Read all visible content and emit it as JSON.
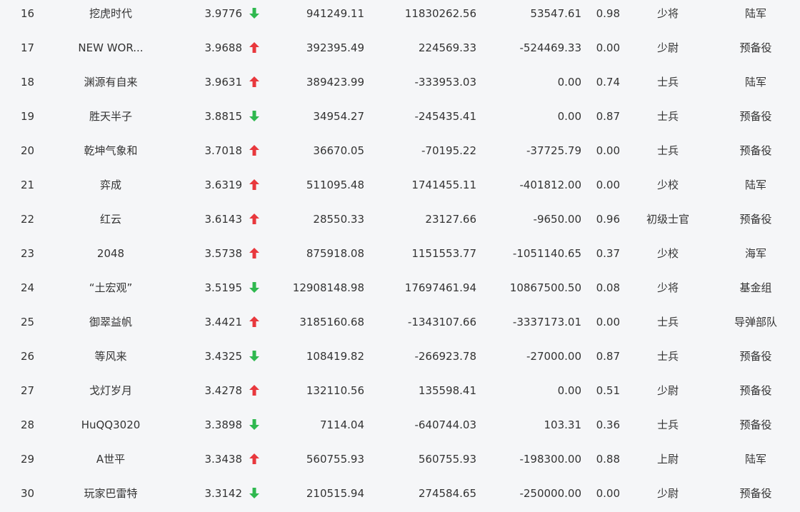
{
  "colors": {
    "up": "#e8383d",
    "down": "#2fb84f",
    "text": "#333333",
    "background": "#f5f6f8"
  },
  "rows": [
    {
      "rank": "16",
      "name": "挖虎时代",
      "score": "3.9776",
      "trend": "down",
      "v1": "941249.11",
      "v2": "11830262.56",
      "v3": "53547.61",
      "ratio": "0.98",
      "level": "少将",
      "unit": "陆军"
    },
    {
      "rank": "17",
      "name": "NEW WOR...",
      "score": "3.9688",
      "trend": "up",
      "v1": "392395.49",
      "v2": "224569.33",
      "v3": "-524469.33",
      "ratio": "0.00",
      "level": "少尉",
      "unit": "预备役"
    },
    {
      "rank": "18",
      "name": "渊源有自来",
      "score": "3.9631",
      "trend": "up",
      "v1": "389423.99",
      "v2": "-333953.03",
      "v3": "0.00",
      "ratio": "0.74",
      "level": "士兵",
      "unit": "陆军"
    },
    {
      "rank": "19",
      "name": "胜天半子",
      "score": "3.8815",
      "trend": "down",
      "v1": "34954.27",
      "v2": "-245435.41",
      "v3": "0.00",
      "ratio": "0.87",
      "level": "士兵",
      "unit": "预备役"
    },
    {
      "rank": "20",
      "name": "乾坤气象和",
      "score": "3.7018",
      "trend": "up",
      "v1": "36670.05",
      "v2": "-70195.22",
      "v3": "-37725.79",
      "ratio": "0.00",
      "level": "士兵",
      "unit": "预备役"
    },
    {
      "rank": "21",
      "name": "弈成",
      "score": "3.6319",
      "trend": "up",
      "v1": "511095.48",
      "v2": "1741455.11",
      "v3": "-401812.00",
      "ratio": "0.00",
      "level": "少校",
      "unit": "陆军"
    },
    {
      "rank": "22",
      "name": "红云",
      "score": "3.6143",
      "trend": "up",
      "v1": "28550.33",
      "v2": "23127.66",
      "v3": "-9650.00",
      "ratio": "0.96",
      "level": "初级士官",
      "unit": "预备役"
    },
    {
      "rank": "23",
      "name": "2048",
      "score": "3.5738",
      "trend": "up",
      "v1": "875918.08",
      "v2": "1151553.77",
      "v3": "-1051140.65",
      "ratio": "0.37",
      "level": "少校",
      "unit": "海军"
    },
    {
      "rank": "24",
      "name": "“土宏观”",
      "score": "3.5195",
      "trend": "down",
      "v1": "12908148.98",
      "v2": "17697461.94",
      "v3": "10867500.50",
      "ratio": "0.08",
      "level": "少将",
      "unit": "基金组"
    },
    {
      "rank": "25",
      "name": "御翠益帆",
      "score": "3.4421",
      "trend": "up",
      "v1": "3185160.68",
      "v2": "-1343107.66",
      "v3": "-3337173.01",
      "ratio": "0.00",
      "level": "士兵",
      "unit": "导弹部队"
    },
    {
      "rank": "26",
      "name": "等风来",
      "score": "3.4325",
      "trend": "down",
      "v1": "108419.82",
      "v2": "-266923.78",
      "v3": "-27000.00",
      "ratio": "0.87",
      "level": "士兵",
      "unit": "预备役"
    },
    {
      "rank": "27",
      "name": "戈灯岁月",
      "score": "3.4278",
      "trend": "up",
      "v1": "132110.56",
      "v2": "135598.41",
      "v3": "0.00",
      "ratio": "0.51",
      "level": "少尉",
      "unit": "预备役"
    },
    {
      "rank": "28",
      "name": "HuQQ3020",
      "score": "3.3898",
      "trend": "down",
      "v1": "7114.04",
      "v2": "-640744.03",
      "v3": "103.31",
      "ratio": "0.36",
      "level": "士兵",
      "unit": "预备役"
    },
    {
      "rank": "29",
      "name": "A世平",
      "score": "3.3438",
      "trend": "up",
      "v1": "560755.93",
      "v2": "560755.93",
      "v3": "-198300.00",
      "ratio": "0.88",
      "level": "上尉",
      "unit": "陆军"
    },
    {
      "rank": "30",
      "name": "玩家巴雷特",
      "score": "3.3142",
      "trend": "down",
      "v1": "210515.94",
      "v2": "274584.65",
      "v3": "-250000.00",
      "ratio": "0.00",
      "level": "少尉",
      "unit": "预备役"
    }
  ]
}
